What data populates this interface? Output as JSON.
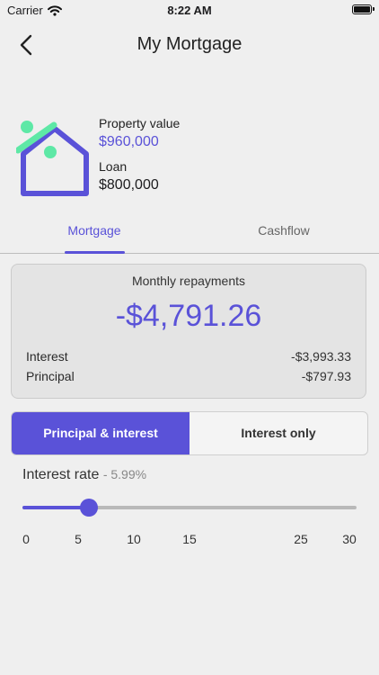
{
  "status_bar": {
    "carrier": "Carrier",
    "time": "8:22 AM"
  },
  "nav": {
    "title": "My Mortgage"
  },
  "property": {
    "value_label": "Property value",
    "value": "$960,000",
    "loan_label": "Loan",
    "loan": "$800,000"
  },
  "tabs": [
    {
      "label": "Mortgage",
      "active": true
    },
    {
      "label": "Cashflow",
      "active": false
    }
  ],
  "repayments": {
    "title": "Monthly repayments",
    "amount": "-$4,791.26",
    "rows": [
      {
        "label": "Interest",
        "value": "-$3,993.33"
      },
      {
        "label": "Principal",
        "value": "-$797.93"
      }
    ]
  },
  "segment": {
    "options": [
      "Principal & interest",
      "Interest only"
    ],
    "selected": "Principal & interest"
  },
  "interest_rate": {
    "label": "Interest rate",
    "value_text": "- 5.99%",
    "value": 5.99,
    "min": 0,
    "max": 30,
    "ticks": [
      "0",
      "5",
      "10",
      "15",
      "25",
      "30"
    ]
  },
  "colors": {
    "accent": "#5a52d8",
    "house_accent": "#5ee8a6",
    "background": "#efefef"
  },
  "icons": [
    "wifi-icon",
    "battery-icon",
    "back-chevron-icon",
    "house-icon"
  ]
}
